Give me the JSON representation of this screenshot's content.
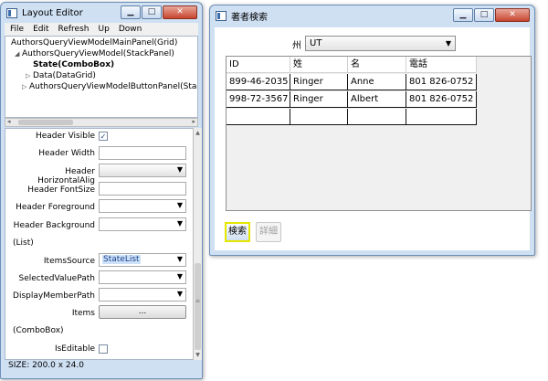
{
  "layout_editor": {
    "title": "Layout Editor",
    "menu": [
      "File",
      "Edit",
      "Refresh",
      "Up",
      "Down"
    ],
    "tree": [
      "AuthorsQueryViewModelMainPanel(Grid)",
      "AuthorsQueryViewModel(StackPanel)",
      "State(ComboBox)",
      "Data(DataGrid)",
      "AuthorsQueryViewModelButtonPanel(StackPan"
    ],
    "props": {
      "header_visible": "Header Visible",
      "header_visible_checked": "✓",
      "header_width": "Header Width",
      "header_horizontal_alig": "Header HorizontalAlig",
      "header_fontsize": "Header FontSize",
      "header_foreground": "Header Foreground",
      "header_background": "Header Background",
      "list_section": "(List)",
      "items_source": "ItemsSource",
      "items_source_value": "StateList",
      "selected_value_path": "SelectedValuePath",
      "display_member_path": "DisplayMemberPath",
      "items": "Items",
      "items_button": "...",
      "combobox_section": "(ComboBox)",
      "is_editable": "IsEditable"
    },
    "status": "SIZE: 200.0 x 24.0"
  },
  "search_window": {
    "title": "著者検索",
    "state_label": "州",
    "state_value": "UT",
    "columns": [
      "ID",
      "姓",
      "名",
      "電話"
    ],
    "rows": [
      [
        "899-46-2035",
        "Ringer",
        "Anne",
        "801 826-0752"
      ],
      [
        "998-72-3567",
        "Ringer",
        "Albert",
        "801 826-0752"
      ]
    ],
    "search_button": "検索",
    "detail_button": "詳細"
  },
  "caption_buttons": {
    "minimize": "▁",
    "maximize": "□",
    "close": "✕"
  },
  "icons": {
    "dropdown": "▼",
    "expand_open": "◢",
    "expand_closed": "▷"
  }
}
